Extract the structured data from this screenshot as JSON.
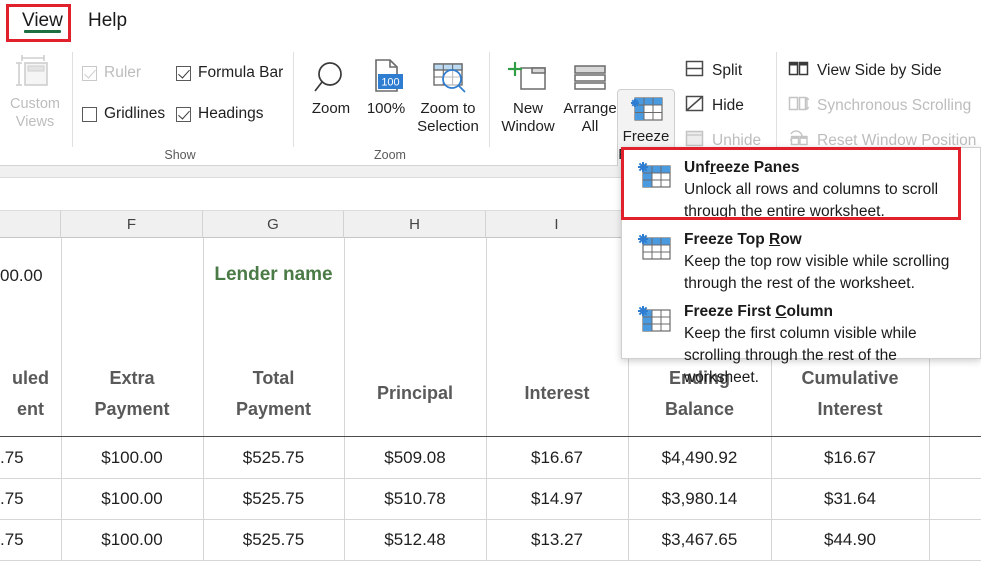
{
  "tabs": [
    {
      "label": "View",
      "active": true
    },
    {
      "label": "Help",
      "active": false
    }
  ],
  "ribbon": {
    "custom_views": {
      "label_line1": "Custom",
      "label_line2": "Views",
      "icon": "custom-views-icon",
      "enabled": false
    },
    "show_group": {
      "label": "Show",
      "checkboxes": [
        {
          "label": "Ruler",
          "checked": true,
          "enabled": false
        },
        {
          "label": "Formula Bar",
          "checked": true,
          "enabled": true
        },
        {
          "label": "Gridlines",
          "checked": false,
          "enabled": true
        },
        {
          "label": "Headings",
          "checked": true,
          "enabled": true
        }
      ]
    },
    "zoom_group": {
      "label": "Zoom",
      "buttons": [
        {
          "label_line1": "Zoom",
          "label_line2": "",
          "icon": "magnifier-icon"
        },
        {
          "label_line1": "100%",
          "label_line2": "",
          "icon": "zoom-100-icon",
          "badge": "100"
        },
        {
          "label_line1": "Zoom to",
          "label_line2": "Selection",
          "icon": "zoom-to-selection-icon"
        }
      ]
    },
    "window_group": {
      "buttons": [
        {
          "label_line1": "New",
          "label_line2": "Window",
          "icon": "new-window-icon"
        },
        {
          "label_line1": "Arrange",
          "label_line2": "All",
          "icon": "arrange-all-icon"
        },
        {
          "label_line1": "Freeze",
          "label_line2": "Panes",
          "icon": "freeze-panes-icon",
          "has_chevron": true,
          "chevron": "⌄",
          "active": true
        }
      ],
      "commands": [
        {
          "label": "Split",
          "icon": "split-icon",
          "enabled": true
        },
        {
          "label": "Hide",
          "icon": "hide-icon",
          "enabled": true
        },
        {
          "label": "Unhide",
          "icon": "unhide-icon",
          "enabled": false
        },
        {
          "label": "View Side by Side",
          "icon": "view-side-by-side-icon",
          "enabled": true
        },
        {
          "label": "Synchronous Scrolling",
          "icon": "synchronous-scrolling-icon",
          "enabled": false
        },
        {
          "label": "Reset Window Position",
          "icon": "reset-window-position-icon",
          "enabled": false
        }
      ]
    }
  },
  "freeze_menu": {
    "items": [
      {
        "title_pre": "Unf",
        "title_accel": "r",
        "title_post": "eeze Panes",
        "title": "Unfreeze Panes",
        "desc_line1": "Unlock all rows and columns to scroll",
        "desc_line2": "through the entire worksheet.",
        "icon": "unfreeze-panes-icon",
        "highlighted": true
      },
      {
        "title_pre": "Freeze Top ",
        "title_accel": "R",
        "title_post": "ow",
        "title": "Freeze Top Row",
        "desc_line1": "Keep the top row visible while scrolling",
        "desc_line2": "through the rest of the worksheet.",
        "icon": "freeze-top-row-icon",
        "highlighted": false
      },
      {
        "title_pre": "Freeze First ",
        "title_accel": "C",
        "title_post": "olumn",
        "title": "Freeze First Column",
        "desc_line1": "Keep the first column visible while",
        "desc_line2": "scrolling through the rest of the worksheet.",
        "icon": "freeze-first-column-icon",
        "highlighted": false
      }
    ]
  },
  "worksheet": {
    "column_headers": [
      "F",
      "G",
      "H",
      "I"
    ],
    "partial_value_left": "00.00",
    "lender_label": "Lender name",
    "table_headers": [
      {
        "line1": "uled",
        "line2": "ent",
        "partial": true
      },
      {
        "line1": "Extra",
        "line2": "Payment"
      },
      {
        "line1": "Total",
        "line2": "Payment"
      },
      {
        "line1": "Principal",
        "line2": ""
      },
      {
        "line1": "Interest",
        "line2": ""
      },
      {
        "line1": "Ending",
        "line2": "Balance"
      },
      {
        "line1": "Cumulative",
        "line2": "Interest"
      }
    ],
    "rows": [
      {
        "scheduled": ".75",
        "extra": "$100.00",
        "total": "$525.75",
        "principal": "$509.08",
        "interest": "$16.67",
        "ending": "$4,490.92",
        "cumulative": "$16.67"
      },
      {
        "scheduled": ".75",
        "extra": "$100.00",
        "total": "$525.75",
        "principal": "$510.78",
        "interest": "$14.97",
        "ending": "$3,980.14",
        "cumulative": "$31.64"
      },
      {
        "scheduled": ".75",
        "extra": "$100.00",
        "total": "$525.75",
        "principal": "$512.48",
        "interest": "$13.27",
        "ending": "$3,467.65",
        "cumulative": "$44.90"
      }
    ]
  },
  "colors": {
    "highlight_red": "#e0202a",
    "tab_accent_green": "#1d6f42",
    "lender_green": "#4a7a46",
    "excel_blue": "#2e7dd1"
  }
}
